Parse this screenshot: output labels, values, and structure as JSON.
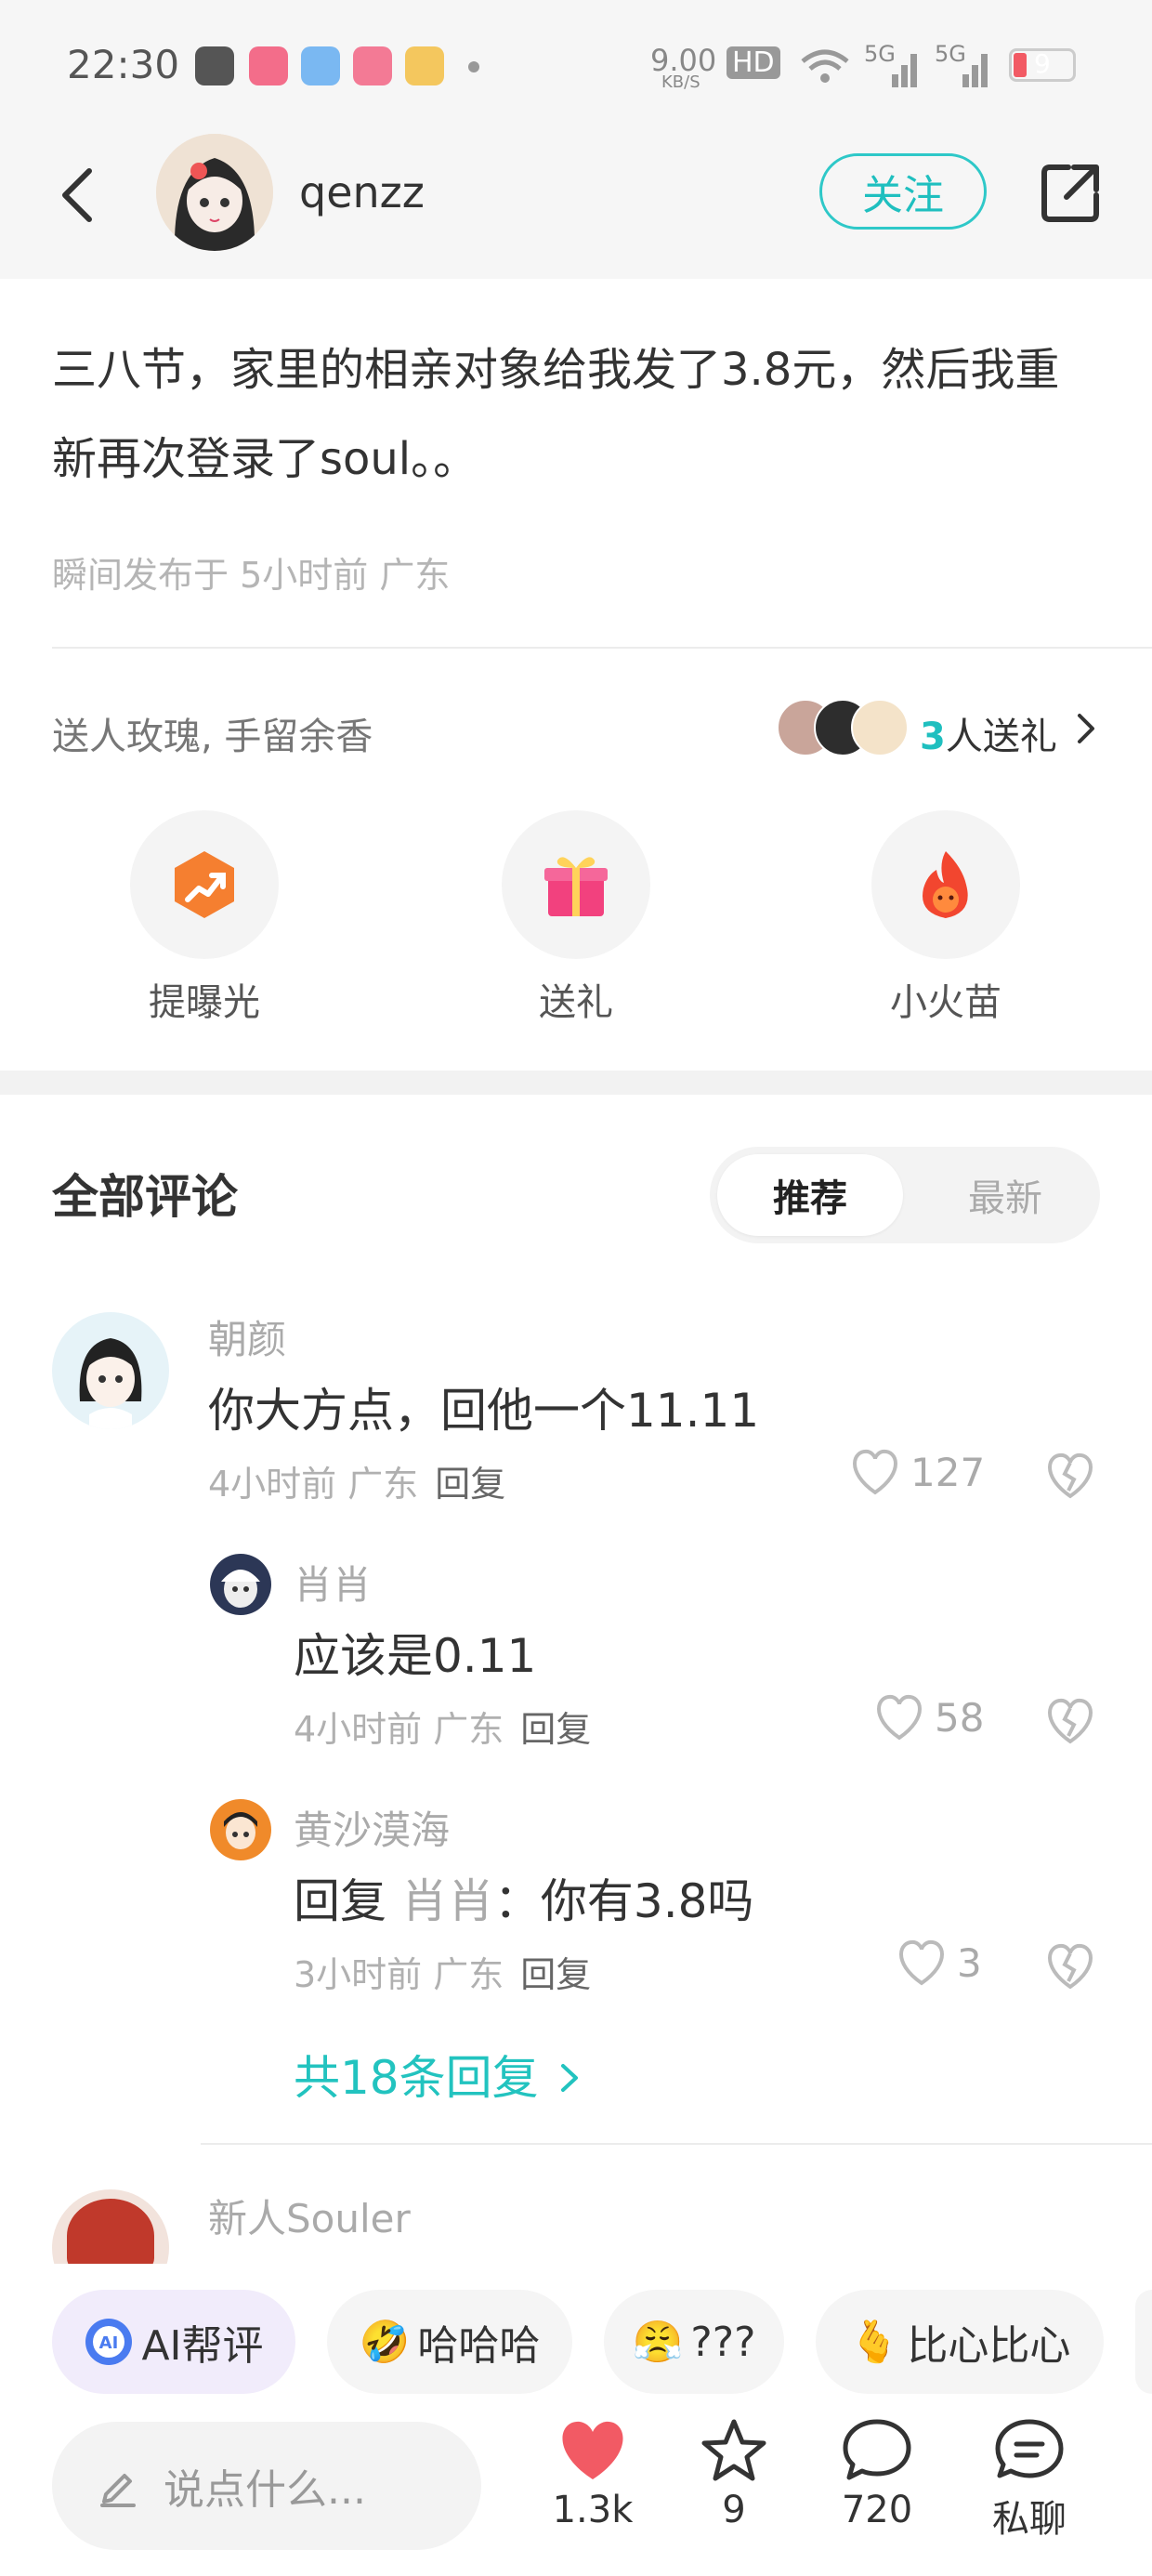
{
  "status_bar": {
    "time": "22:30",
    "network_speed": "9.00",
    "network_unit": "KB/S",
    "hd_label": "HD",
    "signal_1": "5G",
    "signal_2": "5G",
    "battery": "9"
  },
  "header": {
    "username": "qenzz",
    "follow_label": "关注"
  },
  "post": {
    "text": "三八节，家里的相亲对象给我发了3.8元，然后我重新再次登录了soul。。",
    "meta": "瞬间发布于 5小时前 广东"
  },
  "gifts": {
    "tagline": "送人玫瑰, 手留余香",
    "count": "3",
    "count_suffix": "人送礼",
    "actions": [
      {
        "label": "提曝光",
        "icon": "boost-icon"
      },
      {
        "label": "送礼",
        "icon": "gift-icon"
      },
      {
        "label": "小火苗",
        "icon": "flame-icon"
      }
    ]
  },
  "comments_section": {
    "title": "全部评论",
    "tabs": [
      {
        "label": "推荐"
      },
      {
        "label": "最新"
      }
    ]
  },
  "comments": [
    {
      "name": "朝颜",
      "text": "你大方点，回他一个11.11",
      "meta": "4小时前 广东",
      "reply_label": "回复",
      "likes": "127"
    },
    {
      "name": "肖肖",
      "text": "应该是0.11",
      "meta": "4小时前 广东",
      "reply_label": "回复",
      "likes": "58"
    },
    {
      "name": "黄沙漠海",
      "reply_prefix": "回复",
      "reply_to": "肖肖",
      "reply_colon": "：",
      "text": "你有3.8吗",
      "meta": "3小时前 广东",
      "reply_label": "回复",
      "likes": "3"
    },
    {
      "name": "新人Souler"
    }
  ],
  "more_replies": "共18条回复",
  "quick_reactions": [
    {
      "label": "AI帮评"
    },
    {
      "emoji": "🤣",
      "label": "哈哈哈"
    },
    {
      "emoji": "😤",
      "label": "???"
    },
    {
      "emoji": "🫰",
      "label": "比心比心"
    }
  ],
  "bottom_bar": {
    "input_placeholder": "说点什么...",
    "likes": "1.3k",
    "favorites": "9",
    "comments": "720",
    "dm_label": "私聊"
  },
  "colors": {
    "accent": "#22c3bf",
    "heart": "#f25a64"
  }
}
